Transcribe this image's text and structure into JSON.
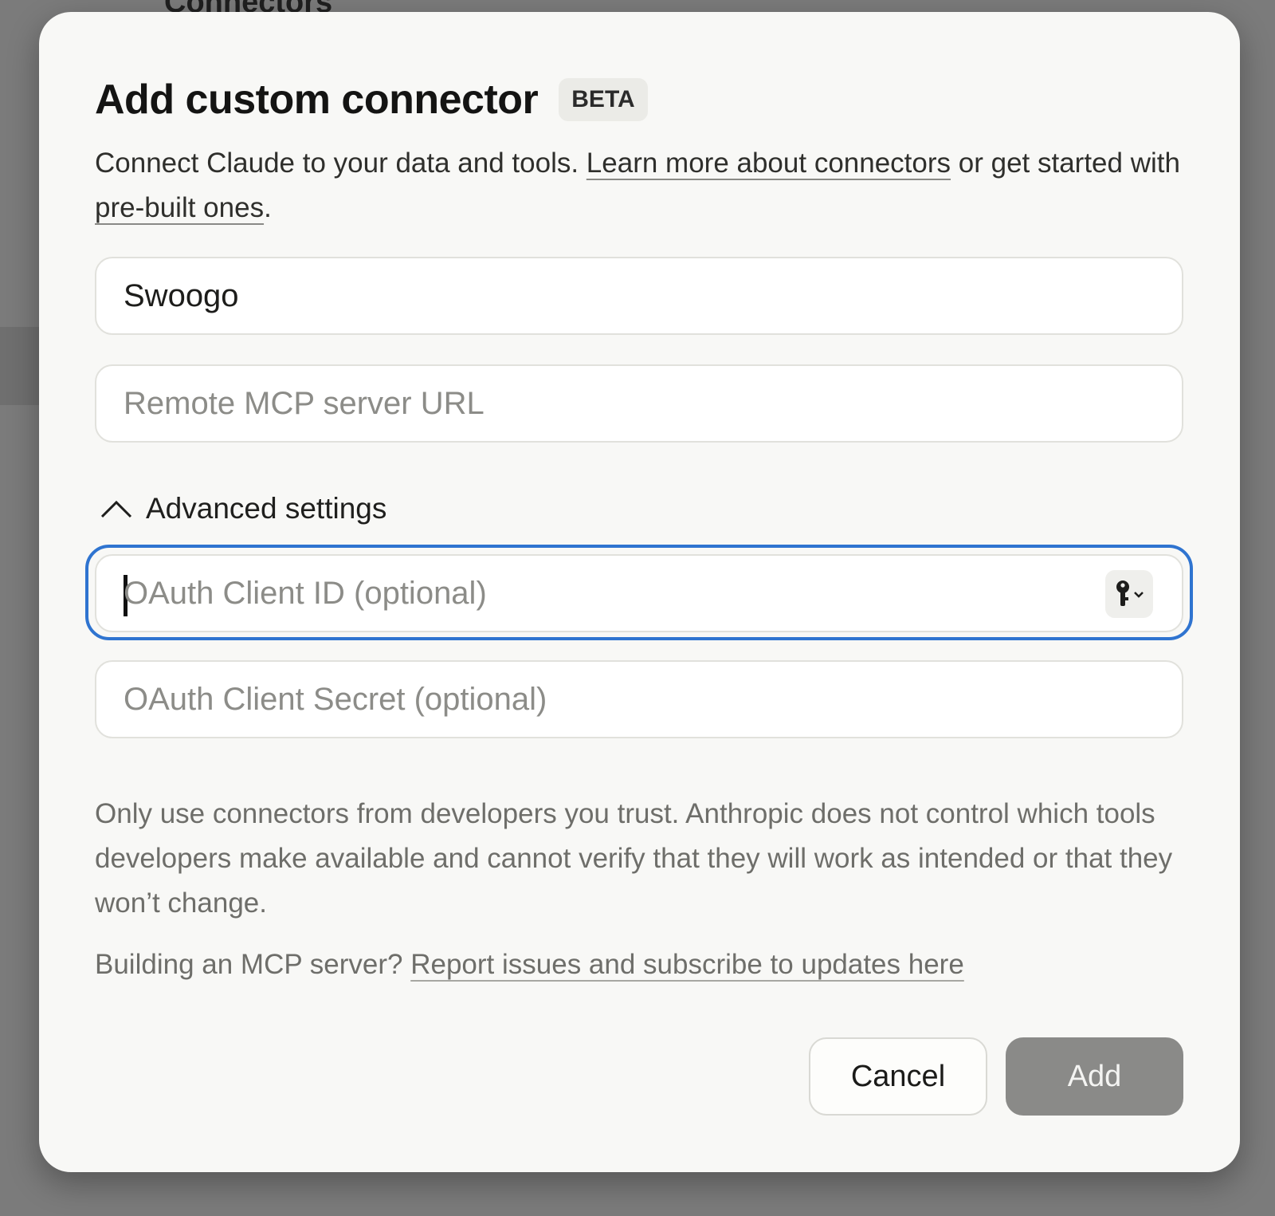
{
  "background": {
    "page_title": "Connectors"
  },
  "dialog": {
    "title": "Add custom connector",
    "badge": "BETA",
    "description": {
      "text_1": "Connect Claude to your data and tools. ",
      "link_learn": "Learn more about connectors",
      "text_2": " or get started with ",
      "link_prebuilt": "pre-built ones",
      "text_3": "."
    },
    "fields": {
      "name": {
        "value": "Swoogo",
        "placeholder": ""
      },
      "url": {
        "value": "",
        "placeholder": "Remote MCP server URL"
      },
      "oauth_client_id": {
        "value": "",
        "placeholder": "OAuth Client ID (optional)",
        "focused": true,
        "autofill_icon": "key-icon"
      },
      "oauth_client_secret": {
        "value": "",
        "placeholder": "OAuth Client Secret (optional)"
      }
    },
    "advanced": {
      "label": "Advanced settings",
      "expanded": true,
      "icon": "chevron-up-icon"
    },
    "warning": "Only use connectors from developers you trust. Anthropic does not control which tools developers make available and cannot verify that they will work as intended or that they won’t change.",
    "mcp_note": {
      "text": "Building an MCP server? ",
      "link": "Report issues and subscribe to updates here"
    },
    "buttons": {
      "cancel": "Cancel",
      "add": "Add",
      "add_disabled": true
    },
    "colors": {
      "focus_ring": "#2f74d0",
      "add_button_disabled": "#8a8a88"
    }
  }
}
